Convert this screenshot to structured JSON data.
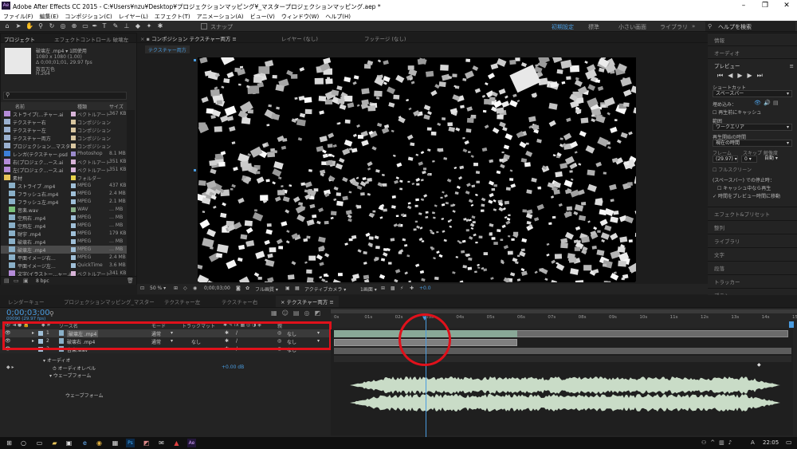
{
  "app": {
    "title": "Adobe After Effects CC 2015 - C:¥Users¥nzu¥Desktop¥プロジェクションマッピング¥_マスタープロジェクションマッピング.aep *",
    "icon": "Ae"
  },
  "menu": [
    "ファイル(F)",
    "編集(E)",
    "コンポジション(C)",
    "レイヤー(L)",
    "エフェクト(T)",
    "アニメーション(A)",
    "ビュー(V)",
    "ウィンドウ(W)",
    "ヘルプ(H)"
  ],
  "toolbar": {
    "snap_label": "スナップ",
    "workspaces": [
      "初期設定",
      "標準",
      "小さい画面",
      "ライブラリ"
    ],
    "active_workspace": "初期設定",
    "search_help": "ヘルプを検索"
  },
  "project": {
    "tab_project": "プロジェクト",
    "tab_effects": "エフェクトコントロール 破壊左",
    "thumb": {
      "name": "破壊左 .mp4 ▾ 1回使用",
      "res": "1080 x 1080 (1.00)",
      "duration": "Δ 0;00;01;01, 29.97 fps",
      "colors": "数百万色",
      "codec": "H.264"
    },
    "columns": [
      "名前",
      "種類",
      "サイズ"
    ],
    "items": [
      {
        "name": "ストライプ(…チャー.ai",
        "kind": "ベクトルアート",
        "size": "367 KB",
        "color": "#d8b4d8",
        "type": "ai"
      },
      {
        "name": "テクスチャー右",
        "kind": "コンポジション",
        "size": "",
        "color": "#d8c6a0",
        "type": "comp"
      },
      {
        "name": "テクスチャー左",
        "kind": "コンポジション",
        "size": "",
        "color": "#d8c6a0",
        "type": "comp"
      },
      {
        "name": "テクスチャー両方",
        "kind": "コンポジション",
        "size": "",
        "color": "#d8c6a0",
        "type": "comp"
      },
      {
        "name": "プロジェクション…マスター",
        "kind": "コンポジション",
        "size": "",
        "color": "#d8c6a0",
        "type": "comp"
      },
      {
        "name": "レンガ(テクスチャー.psd",
        "kind": "Photoshop",
        "size": "8.1 MB",
        "color": "#9a8acb",
        "type": "psd"
      },
      {
        "name": "右(プロジェク…ース.ai",
        "kind": "ベクトルアート",
        "size": "351 KB",
        "color": "#d8b4d8",
        "type": "ai"
      },
      {
        "name": "左(プロジェク…ース.ai",
        "kind": "ベクトルアート",
        "size": "351 KB",
        "color": "#d8b4d8",
        "type": "ai"
      },
      {
        "name": "素材",
        "kind": "フォルダー",
        "size": "",
        "color": "#e8d24a",
        "type": "folder"
      },
      {
        "name": "ストライプ .mp4",
        "kind": "MPEG",
        "size": "437 KB",
        "color": "#a0c0d8",
        "type": "mp4"
      },
      {
        "name": "フラッシュ右.mp4",
        "kind": "MPEG",
        "size": "2.4 MB",
        "color": "#a0c0d8",
        "type": "mp4"
      },
      {
        "name": "フラッシュ左.mp4",
        "kind": "MPEG",
        "size": "2.1 MB",
        "color": "#a0c0d8",
        "type": "mp4"
      },
      {
        "name": "音楽.wav",
        "kind": "WAV",
        "size": "… MB",
        "color": "#88b088",
        "type": "wav"
      },
      {
        "name": "空飛右 .mp4",
        "kind": "MPEG",
        "size": "… MB",
        "color": "#a0c0d8",
        "type": "mp4"
      },
      {
        "name": "空飛左 .mp4",
        "kind": "MPEG",
        "size": "… MB",
        "color": "#a0c0d8",
        "type": "mp4"
      },
      {
        "name": "财宇 .mp4",
        "kind": "MPEG",
        "size": "179 KB",
        "color": "#a0c0d8",
        "type": "mp4"
      },
      {
        "name": "破壊右 .mp4",
        "kind": "MPEG",
        "size": "… MB",
        "color": "#a0c0d8",
        "type": "mp4"
      },
      {
        "name": "破壊左 .mp4",
        "kind": "MPEG",
        "size": "… MB",
        "color": "#a0c0d8",
        "type": "mp4",
        "selected": true
      },
      {
        "name": "平面イメージ右…",
        "kind": "MPEG",
        "size": "2.4 MB",
        "color": "#a0c0d8",
        "type": "mp4"
      },
      {
        "name": "平面イメージ左…",
        "kind": "QuickTime",
        "size": "3.6 MB",
        "color": "#a0c0d8",
        "type": "mov"
      },
      {
        "name": "文字(イラストー…ャー.ai",
        "kind": "ベクトルアート",
        "size": "341 KB",
        "color": "#d8b4d8",
        "type": "ai"
      }
    ],
    "bpc": "8 bpc"
  },
  "comp": {
    "tab_comp": "コンポジション テクスチャー両方",
    "tab_layer": "レイヤー (なし)",
    "tab_footage": "フッテージ (なし)",
    "crumb": "テクスチャー両方",
    "zoom": "50 %",
    "timecode": "0;00;03;00",
    "quality": "フル画質",
    "camera": "アクティブカメラ",
    "views": "1画面",
    "exposure": "+0.0"
  },
  "right": {
    "info": "情報",
    "audio": "オーディオ",
    "preview": "プレビュー",
    "shortcut_label": "ショートカット",
    "shortcut": "スペースバー",
    "include_label": "埋め込み：",
    "cache_label": "再生前にキャッシュ",
    "range_label": "範囲",
    "range": "ワークエリア",
    "start_label": "再生開始の時間",
    "start": "現在の時間",
    "frame_label": "フレーム",
    "skip_label": "スキップ",
    "res_label": "解像度",
    "fps": "(29.97)",
    "skip": "0",
    "res": "自動",
    "fullscreen": "フルスクリーン",
    "stop_label": "(スペースバー) での停止時：",
    "stop_cache": "キャッシュ中なら再生",
    "stop_move": "時間をプレビュー時間に移動",
    "panels": [
      "エフェクト&プリセット",
      "整列",
      "ライブラリ",
      "文字",
      "段落",
      "トラッカー",
      "ブラシ"
    ]
  },
  "timeline": {
    "tabs": [
      "レンダーキュー",
      "プロジェクションマッピング_マスター",
      "テクスチャー左",
      "テクスチャー右",
      "テクスチャー両方"
    ],
    "active_tab": "テクスチャー両方",
    "timecode": "0;00;03;00",
    "frame_info": "00090 (29.97 fps)",
    "col_source": "ソース名",
    "col_mode": "モード",
    "col_trkmat": "トラックマット",
    "col_parent": "親",
    "layers": [
      {
        "num": "1",
        "name": "破壊左 .mp4",
        "mode": "通常",
        "trk": "",
        "parent": "なし"
      },
      {
        "num": "2",
        "name": "破壊右 .mp4",
        "mode": "通常",
        "trk": "なし",
        "parent": "なし"
      },
      {
        "num": "3",
        "name": "音楽.wav",
        "mode": "",
        "trk": "",
        "parent": "なし"
      }
    ],
    "audio_group": "オーディオ",
    "audio_level": "オーディオレベル",
    "audio_level_val": "+0.00 dB",
    "waveform_group": "ウェーブフォーム",
    "waveform_label": "ウェーブフォーム",
    "ruler": [
      "0s",
      "01s",
      "02s",
      "03s",
      "04s",
      "05s",
      "06s",
      "07s",
      "08s",
      "09s",
      "10s",
      "11s",
      "12s",
      "13s",
      "14s",
      "15s"
    ],
    "highlight_color": "#e0111b"
  },
  "taskbar": {
    "time": "22:05",
    "lang": "A"
  }
}
